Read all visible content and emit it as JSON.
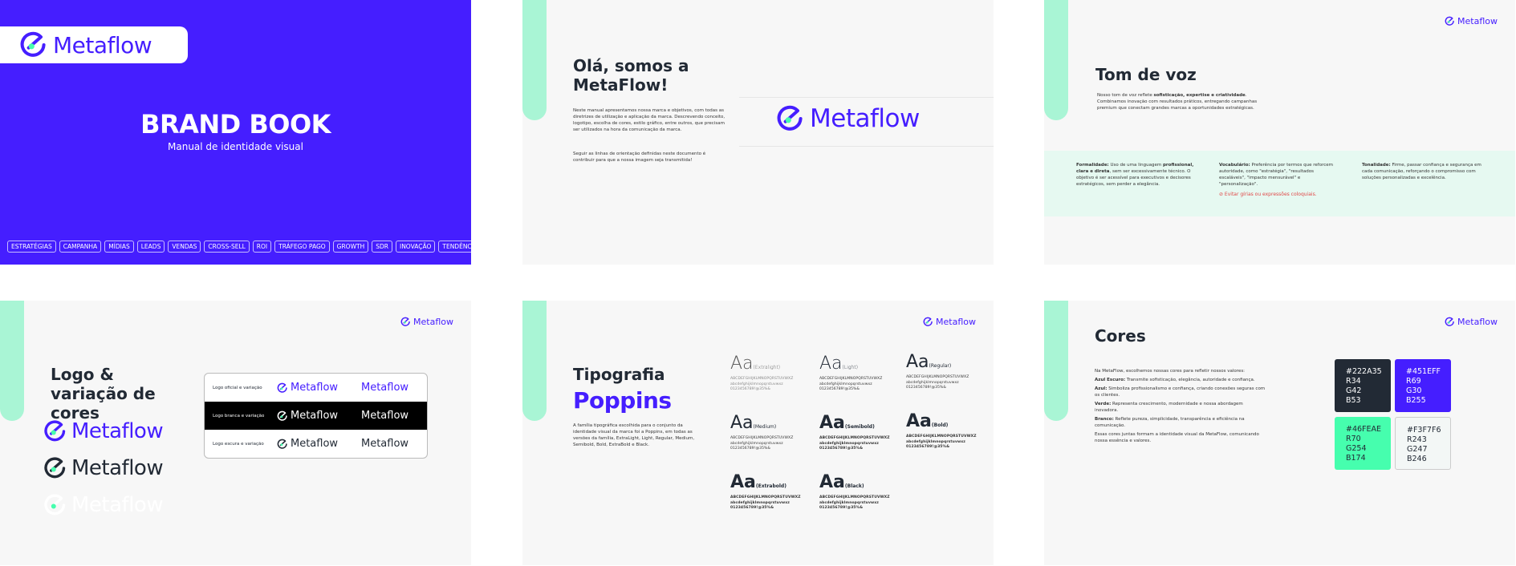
{
  "brand": {
    "name": "Metaflow",
    "colors": {
      "purple": "#451EFF",
      "mint": "#A9F5D5",
      "dark": "#222A35",
      "green": "#46FEAE",
      "light": "#F3F7F6"
    }
  },
  "cover": {
    "title": "BRAND BOOK",
    "subtitle": "Manual de identidade visual",
    "tags": [
      "ESTRATÉGIAS",
      "CAMPANHA",
      "MÍDIAS",
      "LEADS",
      "VENDAS",
      "CROSS-SELL",
      "ROI",
      "TRÁFEGO PAGO",
      "GROWTH",
      "SDR",
      "INOVAÇÃO",
      "TENDÊNCIAS"
    ]
  },
  "intro": {
    "title": "Olá, somos a MetaFlow!",
    "p1": "Neste manual apresentamos nossa marca e objetivos, com todas as diretrizes de utilização e aplicação da marca. Descrevendo conceito, logotipo, escolha de cores, estilo gráfico, entre outros, que precisam ser utilizados na hora da comunicação da marca.",
    "p2": "Seguir as linhas de orientação definidas neste documento é contribuir para que a nossa imagem seja transmitida!"
  },
  "tone": {
    "title": "Tom de voz",
    "intro_a": "Nosso tom de voz reflete ",
    "intro_b": "sofisticação, expertise e criatividade",
    "intro_c": ". Combinamos inovação com resultados práticos, entregando campanhas premium que conectam grandes marcas a oportunidades estratégicas.",
    "cols": [
      {
        "head": "Formalidade:",
        "text": " Uso de uma linguagem ",
        "bold": "profissional, clara e direta",
        "rest": ", sem ser excessivamente técnico. O objetivo é ser acessível para executivos e decisores estratégicos, sem perder a elegância."
      },
      {
        "head": "Vocabulário:",
        "text": " Preferência por termos que reforcem autoridade, como \"estratégia\", \"resultados escaláveis\", \"impacto mensurável\" e \"personalização\".",
        "avoid": "⊘ Evitar gírias ou expressões coloquiais."
      },
      {
        "head": "Tonalidade:",
        "text": " Firme, passar confiança e segurança em cada comunicação, reforçando o compromisso com soluções personalizadas e excelência."
      }
    ]
  },
  "logo": {
    "title": "Logo & variação de cores",
    "rows": [
      {
        "label": "Logo oficial e variação"
      },
      {
        "label": "Logo branca e variação"
      },
      {
        "label": "Logo escura e variação"
      }
    ]
  },
  "type": {
    "title": "Tipografia",
    "font": "Poppins",
    "desc": "A família tipográfica escolhida para o conjunto da identidade visual da marca foi a Poppins, em todas as versões da família, ExtraLight, Light, Regular, Medium, Semibold, Bold, ExtraBold e Black.",
    "aa": "Aa",
    "upper": "ABCDEFGHIJKLMNOPQRSTUVWXZ",
    "lower": "abcdefghijklmnopqrstuvwxz",
    "nums": "0123456789!@35%&",
    "weights": [
      "(Extralight)",
      "(Light)",
      "(Regular)",
      "(Medium)",
      "(Semibold)",
      "(Bold)",
      "(Extrabold)",
      "(Black)"
    ]
  },
  "colors": {
    "title": "Cores",
    "intro": "Na MetaFlow, escolhemos nossas cores para refletir nossos valores:",
    "items": [
      {
        "head": "Azul Escuro:",
        "text": " Transmite sofisticação, elegância, autoridade e confiança."
      },
      {
        "head": "Azul:",
        "text": " Simboliza profissionalismo e confiança, criando conexões seguras com os clientes."
      },
      {
        "head": "Verde:",
        "text": " Representa crescimento, modernidade e nossa abordagem inovadora."
      },
      {
        "head": "Branco:",
        "text": " Reflete pureza, simplicidade, transparência e eficiência na comunicação."
      }
    ],
    "outro": "Essas cores juntas formam a identidade visual da MetaFlow, comunicando nossa essência e valores.",
    "swatches": [
      {
        "hex": "#222A35",
        "r": "R34",
        "g": "G42",
        "b": "B53"
      },
      {
        "hex": "#451EFF",
        "r": "R69",
        "g": "G30",
        "b": "B255"
      },
      {
        "hex": "#46FEAE",
        "r": "R70",
        "g": "G254",
        "b": "B174"
      },
      {
        "hex": "#F3F7F6",
        "r": "R243",
        "g": "G247",
        "b": "B246"
      }
    ]
  }
}
